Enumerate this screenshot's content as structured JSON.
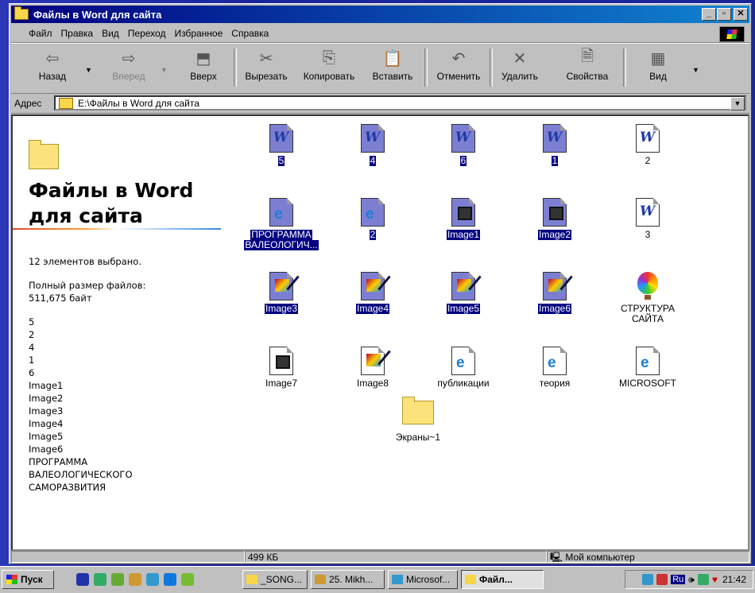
{
  "window": {
    "title": "Файлы в Word для сайта",
    "buttons": {
      "minimize": "_",
      "maximize": "▫",
      "close": "✕"
    }
  },
  "menu": [
    "Файл",
    "Правка",
    "Вид",
    "Переход",
    "Избранное",
    "Справка"
  ],
  "toolbar": {
    "back": "Назад",
    "forward": "Вперед",
    "up": "Вверх",
    "cut": "Вырезать",
    "copy": "Копировать",
    "paste": "Вставить",
    "undo": "Отменить",
    "delete": "Удалить",
    "properties": "Свойства",
    "view": "Вид"
  },
  "address": {
    "label": "Адрес",
    "path": "E:\\Файлы в Word для сайта"
  },
  "panel": {
    "title_line1": "Файлы в Word",
    "title_line2": "для сайта",
    "selected": "12 элементов выбрано.",
    "size_label": "Полный размер файлов:",
    "size_value": "511,675 байт",
    "list": [
      "5",
      "2",
      "4",
      "1",
      "6",
      "Image1",
      "Image2",
      "Image3",
      "Image4",
      "Image5",
      "Image6",
      "ПРОГРАММА",
      "ВАЛЕОЛОГИЧЕСКОГО",
      "САМОРАЗВИТИЯ"
    ]
  },
  "files": {
    "f5": "5",
    "f4": "4",
    "f6": "6",
    "f1": "1",
    "f2w": "2",
    "prog1": "ПРОГРАММА",
    "prog2": "ВАЛЕОЛОГИЧ...",
    "f2ie": "2",
    "image1": "Image1",
    "image2": "Image2",
    "f3": "3",
    "image3": "Image3",
    "image4": "Image4",
    "image5": "Image5",
    "image6": "Image6",
    "struct1": "СТРУКТУРА",
    "struct2": "САЙТА",
    "image7": "Image7",
    "image8": "Image8",
    "pub": "публикации",
    "theory": "теория",
    "ms": "MICROSOFT",
    "screens": "Экраны~1"
  },
  "status": {
    "size": "499 КБ",
    "location": "Мой компьютер"
  },
  "taskbar": {
    "start": "Пуск",
    "tasks": [
      "_SONG...",
      "25. Mikh...",
      "Microsof...",
      "Файл..."
    ],
    "tray_lang": "Ru",
    "clock": "21:42"
  }
}
